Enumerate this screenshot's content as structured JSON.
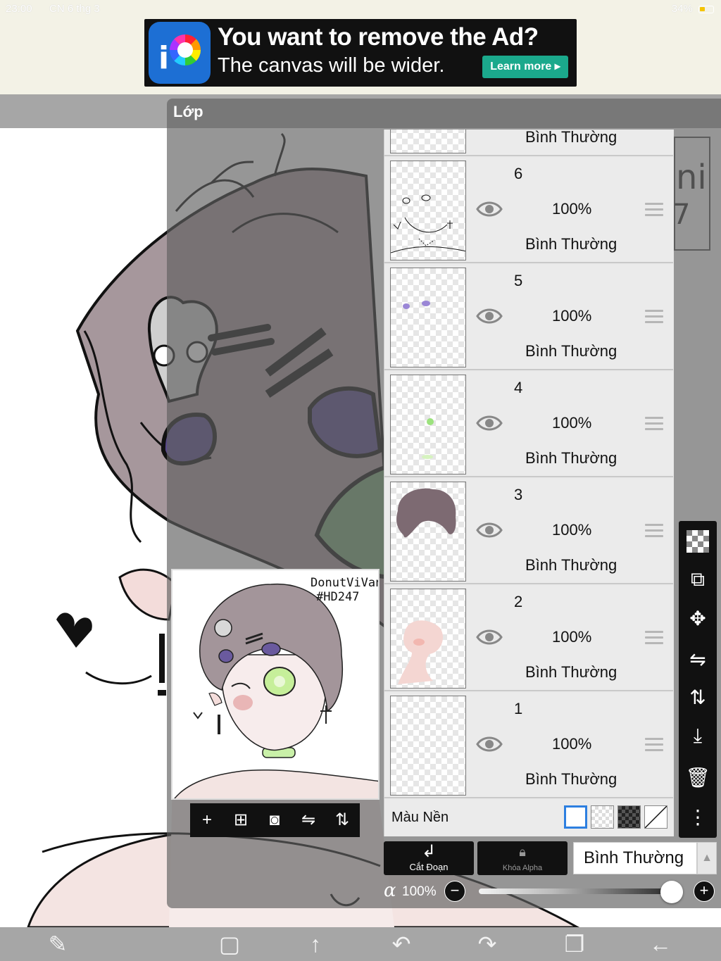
{
  "status_bar": {
    "time": "23:00",
    "date": "CN 6 thg 3",
    "battery": "34%"
  },
  "ad": {
    "headline": "You want to remove the Ad?",
    "subline": "The canvas will be wider.",
    "cta": "Learn more ▸",
    "logo_letter": "i"
  },
  "panel": {
    "title": "Lớp"
  },
  "preview": {
    "watermark_line1": "DonutViVani",
    "watermark_line2": "#HD247"
  },
  "preview_toolbar": [
    {
      "icon": "plus-icon",
      "glyph": "+"
    },
    {
      "icon": "add-layer-icon",
      "glyph": "⊞"
    },
    {
      "icon": "camera-icon",
      "glyph": "◙"
    },
    {
      "icon": "flip-horizontal-icon",
      "glyph": "⇋"
    },
    {
      "icon": "flip-vertical-icon",
      "glyph": "⇅"
    }
  ],
  "layers": [
    {
      "number": "",
      "opacity": "",
      "blend": "Bình Thường",
      "partial": true
    },
    {
      "number": "6",
      "opacity": "100%",
      "blend": "Bình Thường"
    },
    {
      "number": "5",
      "opacity": "100%",
      "blend": "Bình Thường"
    },
    {
      "number": "4",
      "opacity": "100%",
      "blend": "Bình Thường"
    },
    {
      "number": "3",
      "opacity": "100%",
      "blend": "Bình Thường"
    },
    {
      "number": "2",
      "opacity": "100%",
      "blend": "Bình Thường"
    },
    {
      "number": "1",
      "opacity": "100%",
      "blend": "Bình Thường"
    }
  ],
  "background": {
    "label": "Màu Nền",
    "selected": "white"
  },
  "controls": {
    "clip_label": "Cắt Đoạn",
    "alpha_lock_label": "Khóa Alpha",
    "blend_mode": "Bình Thường"
  },
  "opacity": {
    "symbol": "α",
    "value": "100%",
    "level": 1.0
  },
  "right_toolbar": [
    {
      "icon": "transparency-icon"
    },
    {
      "icon": "transform-icon"
    },
    {
      "icon": "move-icon"
    },
    {
      "icon": "flip-horizontal-icon"
    },
    {
      "icon": "flip-vertical-icon"
    },
    {
      "icon": "merge-down-icon"
    },
    {
      "icon": "trash-icon"
    },
    {
      "icon": "more-icon"
    }
  ],
  "bottom_nav": [
    {
      "icon": "edit-tools-icon"
    },
    {
      "icon": "select-icon"
    },
    {
      "icon": "arrow-up-icon"
    },
    {
      "icon": "undo-icon"
    },
    {
      "icon": "redo-icon"
    },
    {
      "icon": "layers-icon"
    },
    {
      "icon": "back-icon"
    }
  ],
  "colors": {
    "panel_overlay": "#5f5f5f",
    "ad_accent": "#1ba98c",
    "toolbar_bg": "#111111",
    "skin": "#f2d9d6",
    "hair": "#8c8088",
    "purple": "#6a5a9e",
    "eye_green": "#6aa06a"
  }
}
